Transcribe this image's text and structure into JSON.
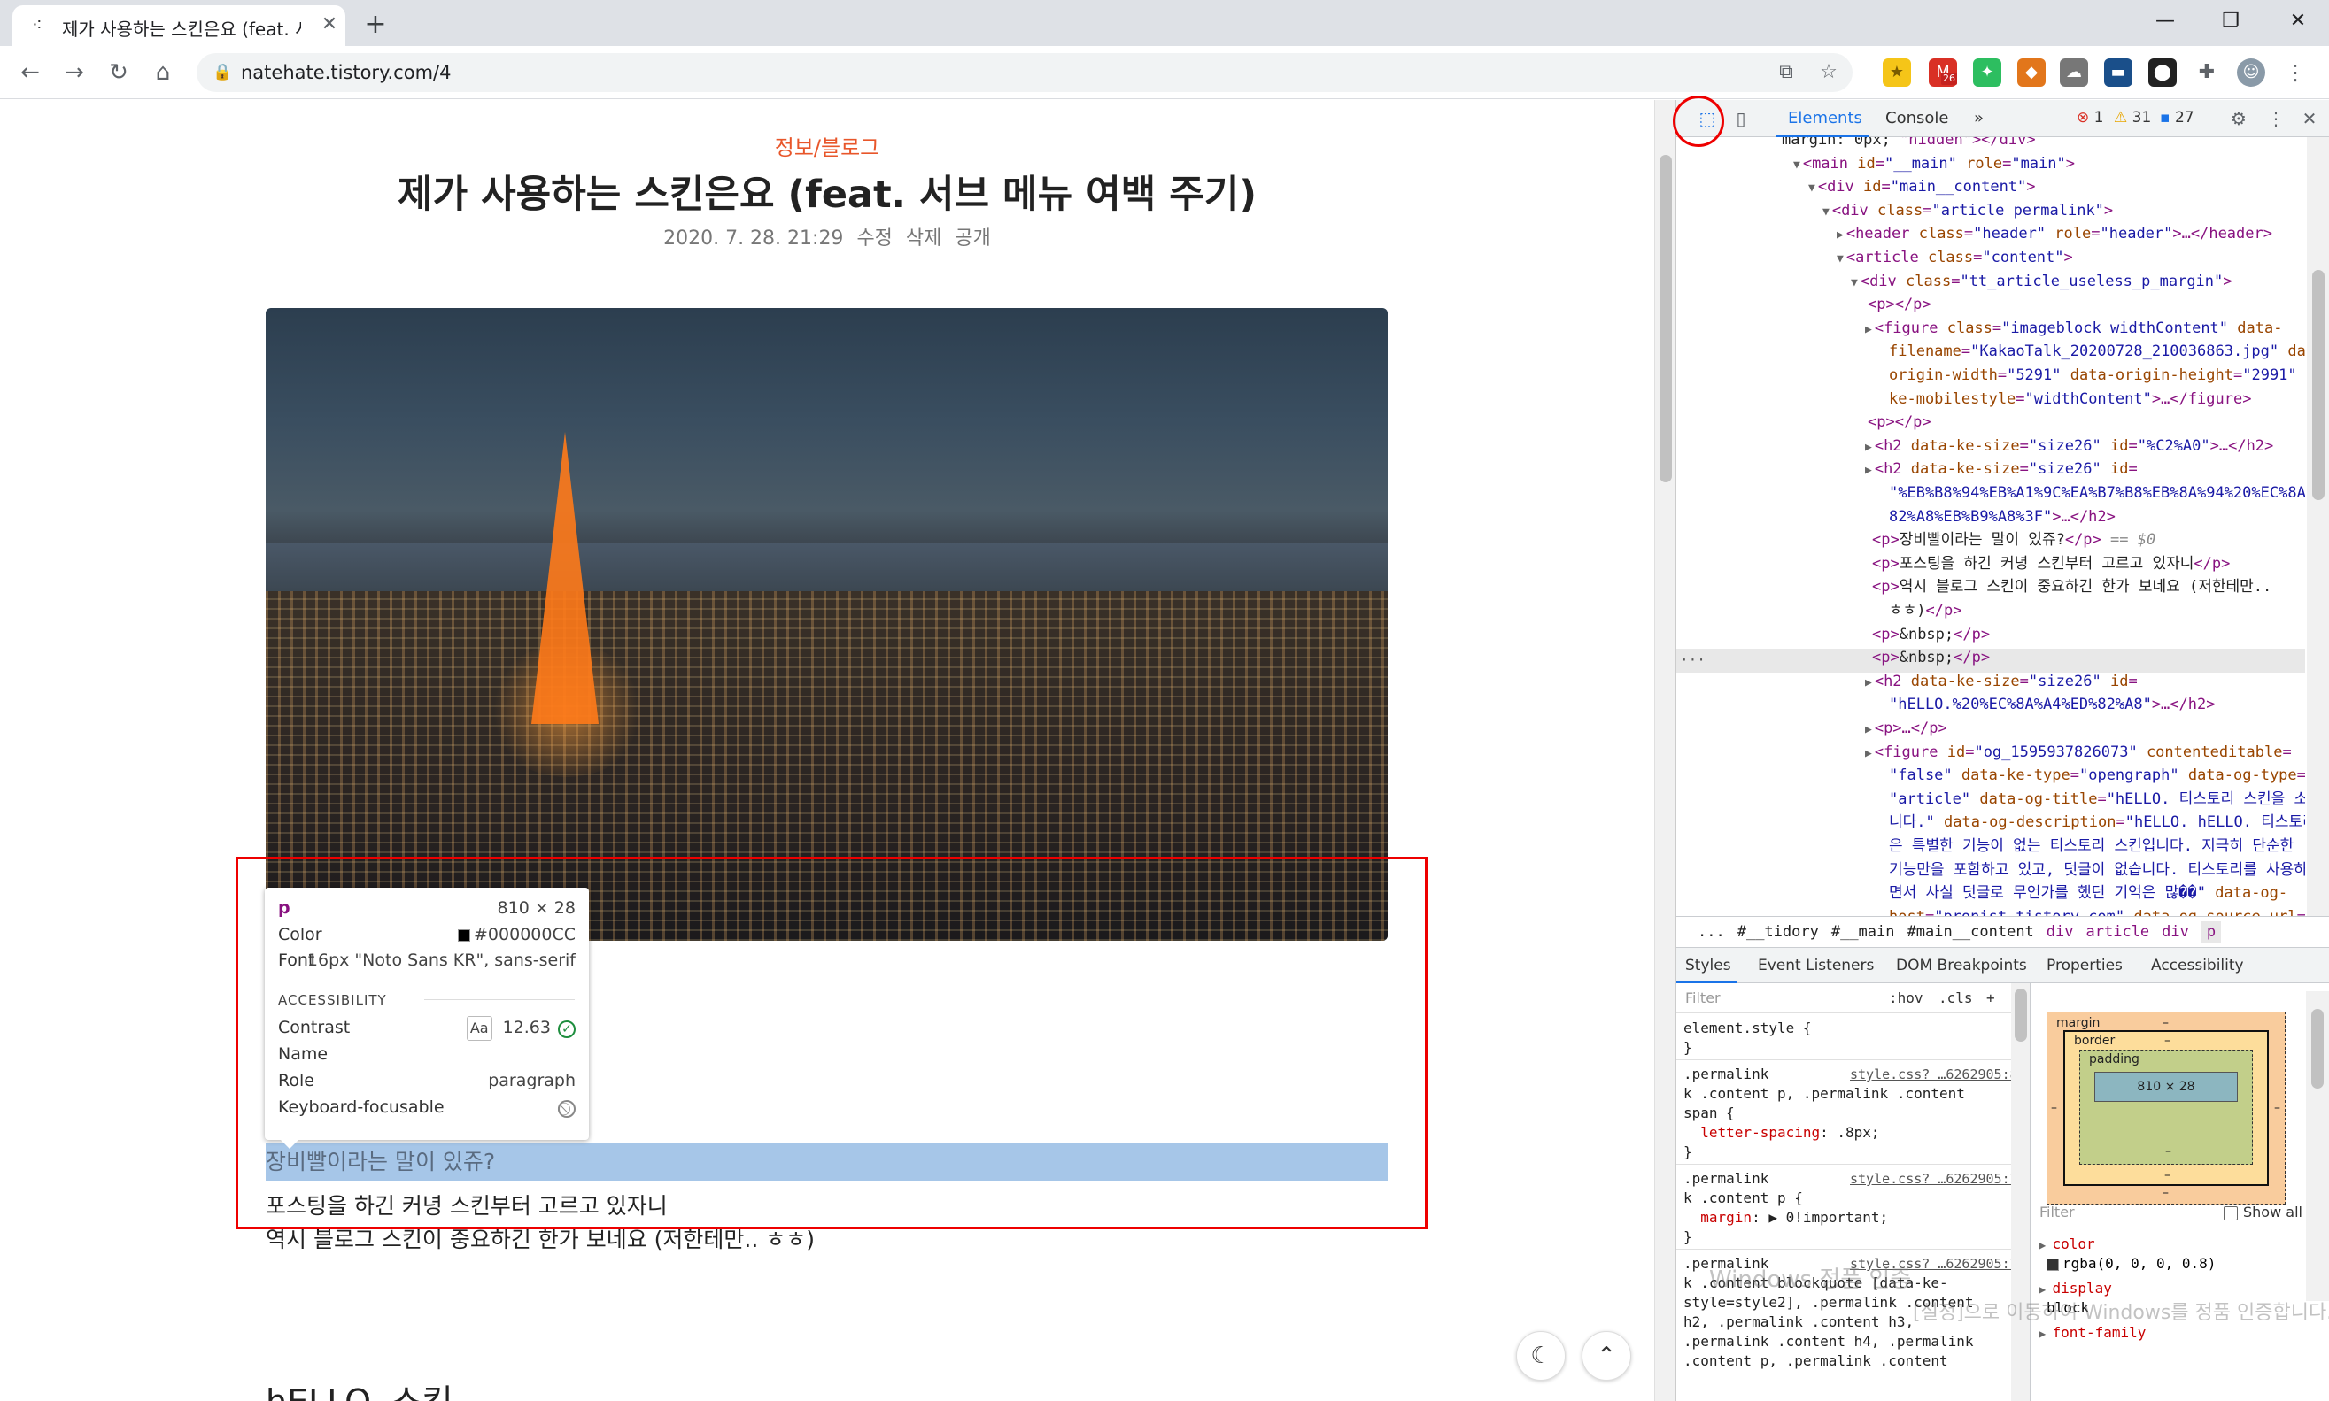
{
  "browser": {
    "tab_title": "제가 사용하는 스킨은요 (feat. 서",
    "tab_favicon": "tistory-icon",
    "url": "natehate.tistory.com/4",
    "ext_badge": "26"
  },
  "post": {
    "category": "정보/블로그",
    "title": "제가 사용하는 스킨은요 (feat. 서브 메뉴 여백 주기)",
    "date": "2020. 7. 28. 21:29",
    "meta_edit": "수정",
    "meta_delete": "삭제",
    "meta_public": "공개",
    "para_selected": "장비빨이라는 말이 있쥬?",
    "para_2": "포스팅을 하긴 커녕 스킨부터 고르고 있자니",
    "para_3": "역시 블로그 스킨이 중요하긴 한가 보네요 (저한테만.. ㅎㅎ)",
    "h2_next": "hELLO. 스킨"
  },
  "inspect_tooltip": {
    "tag": "p",
    "size": "810 × 28",
    "color_label": "Color",
    "color_value": "#000000CC",
    "font_label": "Font",
    "font_value": "16px \"Noto Sans KR\", sans-serif",
    "section": "ACCESSIBILITY",
    "contrast_label": "Contrast",
    "contrast_aa": "Aa",
    "contrast_value": "12.63",
    "name_label": "Name",
    "role_label": "Role",
    "role_value": "paragraph",
    "kbd_label": "Keyboard-focusable"
  },
  "devtools": {
    "tab_elements": "Elements",
    "tab_console": "Console",
    "more": "»",
    "errors": "1",
    "warnings": "31",
    "messages": "27",
    "dom_lines": [
      {
        "indent": 0,
        "html": "<span class='tx'>margin: 0px; </span>\"hidden\"&gt;&lt;/div&gt;"
      },
      {
        "indent": 1,
        "html": "<span class='tri'>▼</span>&lt;main <span class='at'>id</span>=<span class='av'>\"__main\"</span> <span class='at'>role</span>=<span class='av'>\"main\"</span>&gt;"
      },
      {
        "indent": 2,
        "html": "<span class='tri'>▼</span>&lt;div <span class='at'>id</span>=<span class='av'>\"main__content\"</span>&gt;"
      },
      {
        "indent": 3,
        "html": "<span class='tri'>▼</span>&lt;div <span class='at'>class</span>=<span class='av'>\"article permalink\"</span>&gt;"
      },
      {
        "indent": 4,
        "html": "<span class='tri'>▶</span>&lt;header <span class='at'>class</span>=<span class='av'>\"header\"</span> <span class='at'>role</span>=<span class='av'>\"header\"</span>&gt;…&lt;/header&gt;"
      },
      {
        "indent": 4,
        "html": "<span class='tri'>▼</span>&lt;article <span class='at'>class</span>=<span class='av'>\"content\"</span>&gt;"
      },
      {
        "indent": 5,
        "html": "<span class='tri'>▼</span>&lt;div <span class='at'>class</span>=<span class='av'>\"tt_article_useless_p_margin\"</span>&gt;"
      },
      {
        "indent": 6,
        "html": "&lt;p&gt;&lt;/p&gt;"
      },
      {
        "indent": 6,
        "html": "<span class='tri'>▶</span>&lt;figure <span class='at'>class</span>=<span class='av'>\"imageblock widthContent\"</span> <span class='at'>data-</span>"
      },
      {
        "indent": 6,
        "html": "<span class='at'>filename</span>=<span class='av'>\"KakaoTalk_20200728_210036863.jpg\"</span> <span class='at'>data-</span>"
      },
      {
        "indent": 6,
        "html": "<span class='at'>origin-width</span>=<span class='av'>\"5291\"</span> <span class='at'>data-origin-height</span>=<span class='av'>\"2991\"</span> <span class='at'>data-</span>"
      },
      {
        "indent": 6,
        "html": "<span class='at'>ke-mobilestyle</span>=<span class='av'>\"widthContent\"</span>&gt;…&lt;/figure&gt;"
      },
      {
        "indent": 6,
        "html": "&lt;p&gt;&lt;/p&gt;"
      },
      {
        "indent": 6,
        "html": "<span class='tri'>▶</span>&lt;h2 <span class='at'>data-ke-size</span>=<span class='av'>\"size26\"</span> <span class='at'>id</span>=<span class='av'>\"%C2%A0\"</span>&gt;…&lt;/h2&gt;"
      },
      {
        "indent": 6,
        "html": "<span class='tri'>▶</span>&lt;h2 <span class='at'>data-ke-size</span>=<span class='av'>\"size26\"</span> <span class='at'>id</span>="
      },
      {
        "indent": 6,
        "html": "<span class='av'>\"%EB%B8%94%EB%A1%9C%EA%B7%B8%EB%8A%94%20%EC%8A%A4%ED%</span>"
      },
      {
        "indent": 6,
        "html": "<span class='av'>82%A8%EB%B9%A8%3F\"</span>&gt;…&lt;/h2&gt;"
      },
      {
        "indent": 7,
        "html": "&lt;p&gt;<span class='tx'>장비빨이라는 말이 있쥬?</span>&lt;/p&gt; <span class='dim'>== $0</span>"
      },
      {
        "indent": 7,
        "html": "&lt;p&gt;<span class='tx'>포스팅을 하긴 커녕 스킨부터 고르고 있자니</span>&lt;/p&gt;"
      },
      {
        "indent": 7,
        "html": "&lt;p&gt;<span class='tx'>역시 블로그 스킨이 중요하긴 한가 보네요 (저한테만..</span>"
      },
      {
        "indent": 7,
        "html": "<span class='tx'>ㅎㅎ)</span>&lt;/p&gt;"
      },
      {
        "indent": 7,
        "html": "&lt;p&gt;<span class='tx'>&amp;nbsp;</span>&lt;/p&gt;"
      },
      {
        "indent": 7,
        "html": "&lt;p&gt;<span class='tx'>&amp;nbsp;</span>&lt;/p&gt;"
      },
      {
        "indent": 6,
        "html": "<span class='tri'>▶</span>&lt;h2 <span class='at'>data-ke-size</span>=<span class='av'>\"size26\"</span> <span class='at'>id</span>="
      },
      {
        "indent": 6,
        "html": "<span class='av'>\"hELLO.%20%EC%8A%A4%ED%82%A8\"</span>&gt;…&lt;/h2&gt;"
      },
      {
        "indent": 6,
        "html": "<span class='tri'>▶</span>&lt;p&gt;…&lt;/p&gt;"
      },
      {
        "indent": 6,
        "html": "<span class='tri'>▶</span>&lt;figure <span class='at'>id</span>=<span class='av'>\"og_1595937826073\"</span> <span class='at'>contenteditable</span>="
      },
      {
        "indent": 6,
        "html": "<span class='av'>\"false\"</span> <span class='at'>data-ke-type</span>=<span class='av'>\"opengraph\"</span> <span class='at'>data-og-type</span>="
      },
      {
        "indent": 6,
        "html": "<span class='av'>\"article\"</span> <span class='at'>data-og-title</span>=<span class='av'>\"hELLO. 티스토리 스킨을 소개합</span>"
      },
      {
        "indent": 6,
        "html": "<span class='av'>니다.\"</span> <span class='at'>data-og-description</span>=<span class='av'>\"hELLO. hELLO. 티스토리 스킨</span>"
      },
      {
        "indent": 6,
        "html": "<span class='av'>은 특별한 기능이 없는 티스토리 스킨입니다. 지극히 단순한</span>"
      },
      {
        "indent": 6,
        "html": "<span class='av'>기능만을 포함하고 있고, 덧글이 없습니다. 티스토리를 사용하</span>"
      },
      {
        "indent": 6,
        "html": "<span class='av'>면서 사실 덧글로 무언가를 했던 기억은 많��\"</span> <span class='at'>data-og-</span>"
      },
      {
        "indent": 6,
        "html": "<span class='at'>host</span>=<span class='av'>\"pronist.tistory.com\"</span> <span class='at'>data-og-source-url</span>=<span class='av'>\"https:</span>"
      },
      {
        "indent": 6,
        "html": "<span class='av'>//pronist.tistory.com/5\"</span> <span class='at'>data-og-url</span>=<span class='av'>\"https://</span>"
      }
    ],
    "crumbs": [
      "...",
      "#__tidory",
      "#__main",
      "#main__content",
      "div",
      "article",
      "div",
      "p"
    ],
    "styles_tabs": [
      "Styles",
      "Event Listeners",
      "DOM Breakpoints",
      "Properties",
      "Accessibility"
    ],
    "filter_placeholder": "Filter",
    "filter_hov": ":hov",
    "filter_cls": ".cls",
    "filter_plus": "+",
    "style_lines": [
      "element.style {",
      "}",
      ".permalink",
      "k .content p, .permalink .content",
      "span {",
      "  letter-spacing: .8px;",
      "}",
      ".permalink",
      "k .content p {",
      "  margin: ▶ 0!important;",
      "}",
      ".permalink",
      "k .content blockquote [data-ke-",
      "style=style2], .permalink .content",
      "h2, .permalink .content h3,",
      ".permalink .content h4, .permalink",
      ".content p, .permalink .content"
    ],
    "style_sources": [
      "style.css? …6262905:869",
      "style.css? …6262905:758",
      "style.css? …6262905:755"
    ],
    "boxmodel": {
      "margin": "margin",
      "border": "border",
      "padding": "padding",
      "content": "810 × 28",
      "dash": "–"
    },
    "computed_filter": "Filter",
    "computed_showall": "Show all",
    "computed": [
      {
        "prop": "color",
        "val": "rgba(0, 0, 0, 0.8)"
      },
      {
        "prop": "display",
        "val": "block"
      },
      {
        "prop": "font-family",
        "val": ""
      }
    ],
    "watermark_1": "Windows 정품 인증",
    "watermark_2": "[설정]으로 이동하여 Windows를 정품 인증합니다."
  }
}
